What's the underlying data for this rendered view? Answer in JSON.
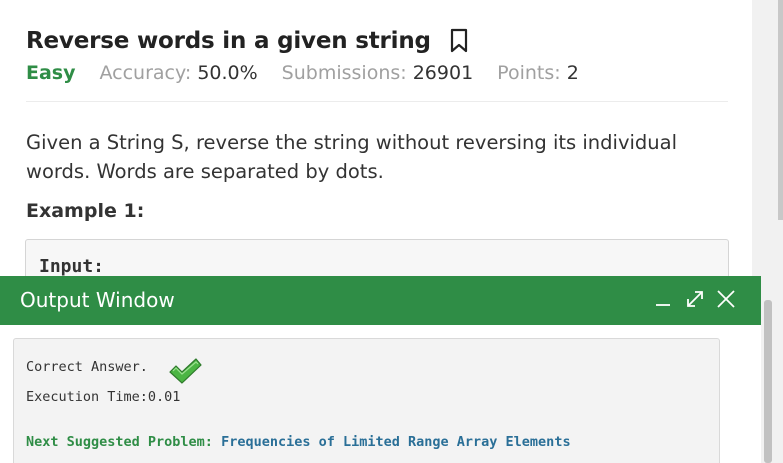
{
  "problem": {
    "title": "Reverse words in a given string",
    "difficulty": "Easy",
    "accuracy_label": "Accuracy:",
    "accuracy_value": "50.0%",
    "submissions_label": "Submissions:",
    "submissions_value": "26901",
    "points_label": "Points:",
    "points_value": "2",
    "description": "Given a String S, reverse the string without reversing its individual words. Words are separated by dots.",
    "example_heading": "Example 1:",
    "example_input_label": "Input:"
  },
  "output_window": {
    "title": "Output Window",
    "correct_answer": "Correct Answer.",
    "execution_time": "Execution Time:0.01",
    "next_label": "Next Suggested Problem:",
    "next_problem": "Frequencies of Limited Range Array Elements",
    "icons": {
      "minimize": "minimize-icon",
      "maximize": "maximize-icon",
      "close": "close-icon",
      "success": "check-icon"
    }
  },
  "colors": {
    "brand_green": "#2f8d46",
    "link_blue": "#2a6f97"
  }
}
